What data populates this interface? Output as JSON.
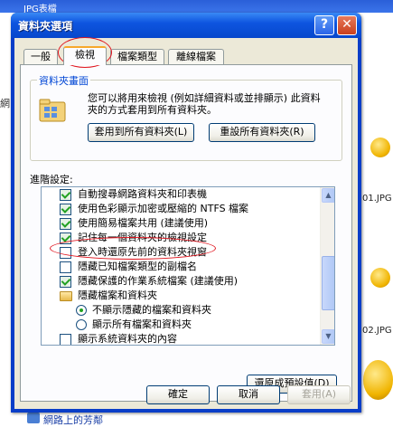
{
  "background": {
    "window_title": "JPG表檔",
    "left_partial": "網",
    "thumb_label_1": "01.JPG",
    "thumb_label_2": "02.JPG",
    "bottom_link": "網路上的芳鄰"
  },
  "dialog": {
    "title": "資料夾選項",
    "help_button": "?",
    "close_button": "✕"
  },
  "tabs": [
    {
      "label": "一般"
    },
    {
      "label": "檢視"
    },
    {
      "label": "檔案類型"
    },
    {
      "label": "離線檔案"
    }
  ],
  "folder_views": {
    "legend": "資料夾畫面",
    "description": "您可以將用來檢視 (例如詳細資料或並排顯示) 此資料夾的方式套用到所有資料夾。",
    "apply_all_button": "套用到所有資料夾(L)",
    "reset_all_button": "重設所有資料夾(R)"
  },
  "advanced": {
    "label": "進階設定:",
    "items": [
      {
        "type": "checkbox",
        "checked": true,
        "label": "自動搜尋網路資料夾和印表機"
      },
      {
        "type": "checkbox",
        "checked": true,
        "label": "使用色彩顯示加密或壓縮的 NTFS 檔案"
      },
      {
        "type": "checkbox",
        "checked": true,
        "label": "使用簡易檔案共用 (建議使用)"
      },
      {
        "type": "checkbox",
        "checked": true,
        "label": "記住每一個資料夾的檢視設定"
      },
      {
        "type": "checkbox",
        "checked": false,
        "label": "登入時還原先前的資料夾視窗"
      },
      {
        "type": "checkbox",
        "checked": false,
        "label": "隱藏已知檔案類型的副檔名"
      },
      {
        "type": "checkbox",
        "checked": true,
        "label": "隱藏保護的作業系統檔案 (建議使用)"
      },
      {
        "type": "folder",
        "label": "隱藏檔案和資料夾"
      },
      {
        "type": "radio",
        "selected": true,
        "label": "不顯示隱藏的檔案和資料夾"
      },
      {
        "type": "radio",
        "selected": false,
        "label": "顯示所有檔案和資料夾"
      },
      {
        "type": "checkbox",
        "checked": false,
        "label": "顯示系統資料夾的內容"
      }
    ],
    "restore_defaults_button": "還原成預設值(D)"
  },
  "footer": {
    "ok_button": "確定",
    "cancel_button": "取消",
    "apply_button": "套用(A)"
  },
  "colors": {
    "titlebar": "#0a56e0",
    "dialog_face": "#ece9d8",
    "annotation": "#e0141e",
    "check_green": "#21a121"
  }
}
